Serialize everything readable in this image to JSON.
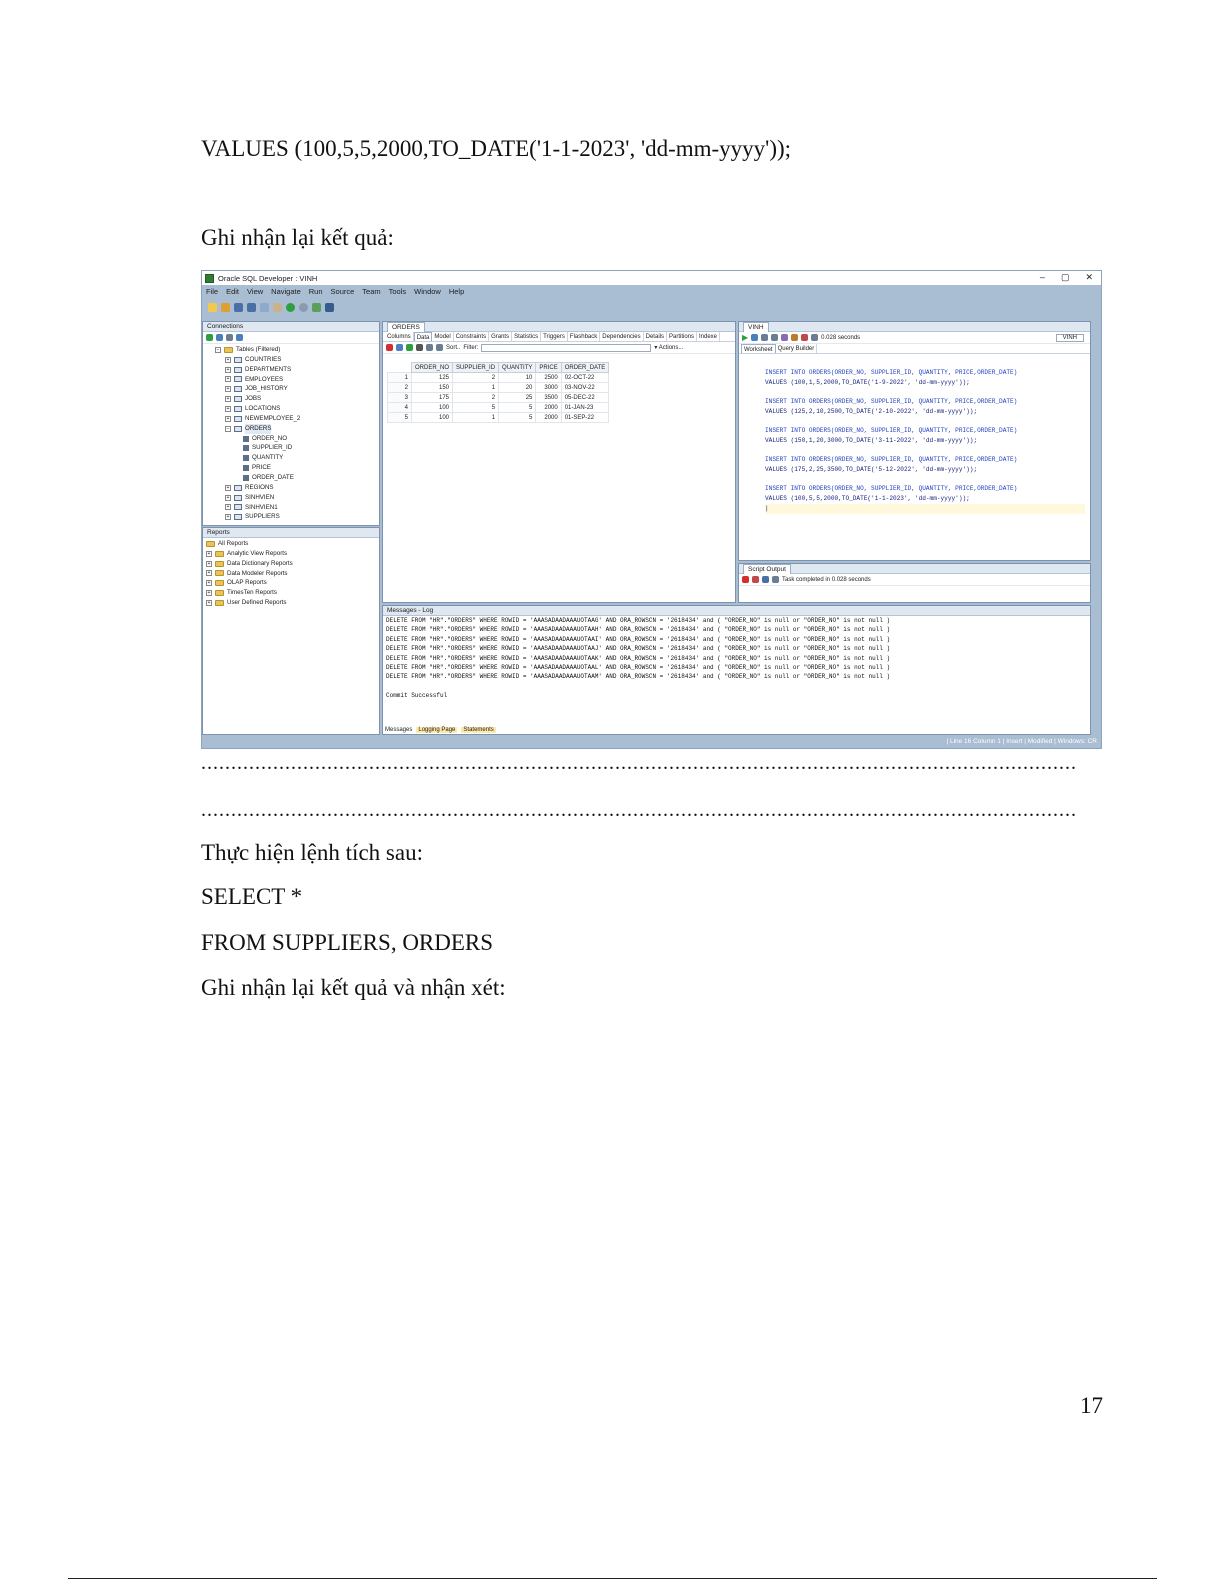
{
  "document": {
    "line_values": "VALUES (100,5,5,2000,TO_DATE('1-1-2023', 'dd-mm-yyyy'));",
    "line_record": "Ghi nhận lại kết quả:",
    "dots_1": "..................................................................................................................................................",
    "dots_2": "..................................................................................................................................................",
    "line_execute": "Thực hiện lệnh tích sau:",
    "line_select": "SELECT *",
    "line_from": "FROM SUPPLIERS, ORDERS",
    "line_record_comment": "Ghi nhận lại kết quả và nhận xét:",
    "page_number": "17"
  },
  "screenshot": {
    "window_title": "Oracle SQL Developer : VINH",
    "window_controls": [
      "–",
      "▢",
      "✕"
    ],
    "menu": [
      "File",
      "Edit",
      "View",
      "Navigate",
      "Run",
      "Source",
      "Team",
      "Tools",
      "Window",
      "Help"
    ],
    "connections": {
      "title": "Connections",
      "tables_node": "Tables (Filtered)",
      "tables": [
        "COUNTRIES",
        "DEPARTMENTS",
        "EMPLOYEES",
        "JOB_HISTORY",
        "JOBS",
        "LOCATIONS",
        "NEWEMPLOYEE_2",
        "ORDERS"
      ],
      "order_columns": [
        "ORDER_NO",
        "SUPPLIER_ID",
        "QUANTITY",
        "PRICE",
        "ORDER_DATE"
      ],
      "tables_after": [
        "REGIONS",
        "SINHVIEN",
        "SINHVIEN1",
        "SUPPLIERS"
      ]
    },
    "reports": {
      "title": "Reports",
      "items": [
        "All Reports",
        "Analytic View Reports",
        "Data Dictionary Reports",
        "Data Modeler Reports",
        "OLAP Reports",
        "TimesTen Reports",
        "User Defined Reports"
      ]
    },
    "orders_tab": {
      "tab_label": "ORDERS",
      "subtabs": [
        "Columns",
        "Data",
        "Model",
        "Constraints",
        "Grants",
        "Statistics",
        "Triggers",
        "Flashback",
        "Dependencies",
        "Details",
        "Partitions",
        "Indexe"
      ],
      "sort_label": "Sort..",
      "filter_label": "Filter:",
      "actions_label": "▾ Actions...",
      "headers": [
        "ORDER_NO",
        "SUPPLIER_ID",
        "QUANTITY",
        "PRICE",
        "ORDER_DATE"
      ],
      "rows": [
        {
          "n": "1",
          "order_no": "125",
          "supplier_id": "2",
          "quantity": "10",
          "price": "2500",
          "order_date": "02-OCT-22"
        },
        {
          "n": "2",
          "order_no": "150",
          "supplier_id": "1",
          "quantity": "20",
          "price": "3000",
          "order_date": "03-NOV-22"
        },
        {
          "n": "3",
          "order_no": "175",
          "supplier_id": "2",
          "quantity": "25",
          "price": "3500",
          "order_date": "05-DEC-22"
        },
        {
          "n": "4",
          "order_no": "100",
          "supplier_id": "5",
          "quantity": "5",
          "price": "2000",
          "order_date": "01-JAN-23"
        },
        {
          "n": "5",
          "order_no": "100",
          "supplier_id": "1",
          "quantity": "5",
          "price": "2000",
          "order_date": "01-SEP-22"
        }
      ]
    },
    "worksheet": {
      "tab_label": "VINH",
      "elapsed": "0.028 seconds",
      "connection": "VINH",
      "subtabs": [
        "Worksheet",
        "Query Builder"
      ],
      "insert_line": "INSERT INTO ORDERS(ORDER_NO, SUPPLIER_ID, QUANTITY, PRICE,ORDER_DATE)",
      "values_lines": [
        "VALUES (100,1,5,2000,TO_DATE('1-9-2022', 'dd-mm-yyyy'));",
        "VALUES (125,2,10,2500,TO_DATE('2-10-2022', 'dd-mm-yyyy'));",
        "VALUES (150,1,20,3000,TO_DATE('3-11-2022', 'dd-mm-yyyy'));",
        "VALUES (175,2,25,3500,TO_DATE('5-12-2022', 'dd-mm-yyyy'));",
        "VALUES (100,5,5,2000,TO_DATE('1-1-2023', 'dd-mm-yyyy'));"
      ]
    },
    "script_output": {
      "tab_label": "Script Output",
      "message": "Task completed in 0.028 seconds"
    },
    "messages_log": {
      "title": "Messages - Log",
      "lines": [
        "DELETE FROM \"HR\".\"ORDERS\" WHERE ROWID = 'AAASADAADAAAUOTAAG' AND ORA_ROWSCN = '2618434' and ( \"ORDER_NO\" is null or \"ORDER_NO\" is not null )",
        "DELETE FROM \"HR\".\"ORDERS\" WHERE ROWID = 'AAASADAADAAAUOTAAH' AND ORA_ROWSCN = '2618434' and ( \"ORDER_NO\" is null or \"ORDER_NO\" is not null )",
        "DELETE FROM \"HR\".\"ORDERS\" WHERE ROWID = 'AAASADAADAAAUOTAAI' AND ORA_ROWSCN = '2618434' and ( \"ORDER_NO\" is null or \"ORDER_NO\" is not null )",
        "DELETE FROM \"HR\".\"ORDERS\" WHERE ROWID = 'AAASADAADAAAUOTAAJ' AND ORA_ROWSCN = '2618434' and ( \"ORDER_NO\" is null or \"ORDER_NO\" is not null )",
        "DELETE FROM \"HR\".\"ORDERS\" WHERE ROWID = 'AAASADAADAAAUOTAAK' AND ORA_ROWSCN = '2618434' and ( \"ORDER_NO\" is null or \"ORDER_NO\" is not null )",
        "DELETE FROM \"HR\".\"ORDERS\" WHERE ROWID = 'AAASADAADAAAUOTAAL' AND ORA_ROWSCN = '2618434' and ( \"ORDER_NO\" is null or \"ORDER_NO\" is not null )",
        "DELETE FROM \"HR\".\"ORDERS\" WHERE ROWID = 'AAASADAADAAAUOTAAM' AND ORA_ROWSCN = '2618434' and ( \"ORDER_NO\" is null or \"ORDER_NO\" is not null )"
      ],
      "commit": "Commit Successful",
      "bottom_tabs": [
        "Messages",
        "Logging Page",
        "Statements"
      ]
    },
    "status_bar": "| Line 16 Column 1     | Insert     | Modified | Windows: CR"
  }
}
